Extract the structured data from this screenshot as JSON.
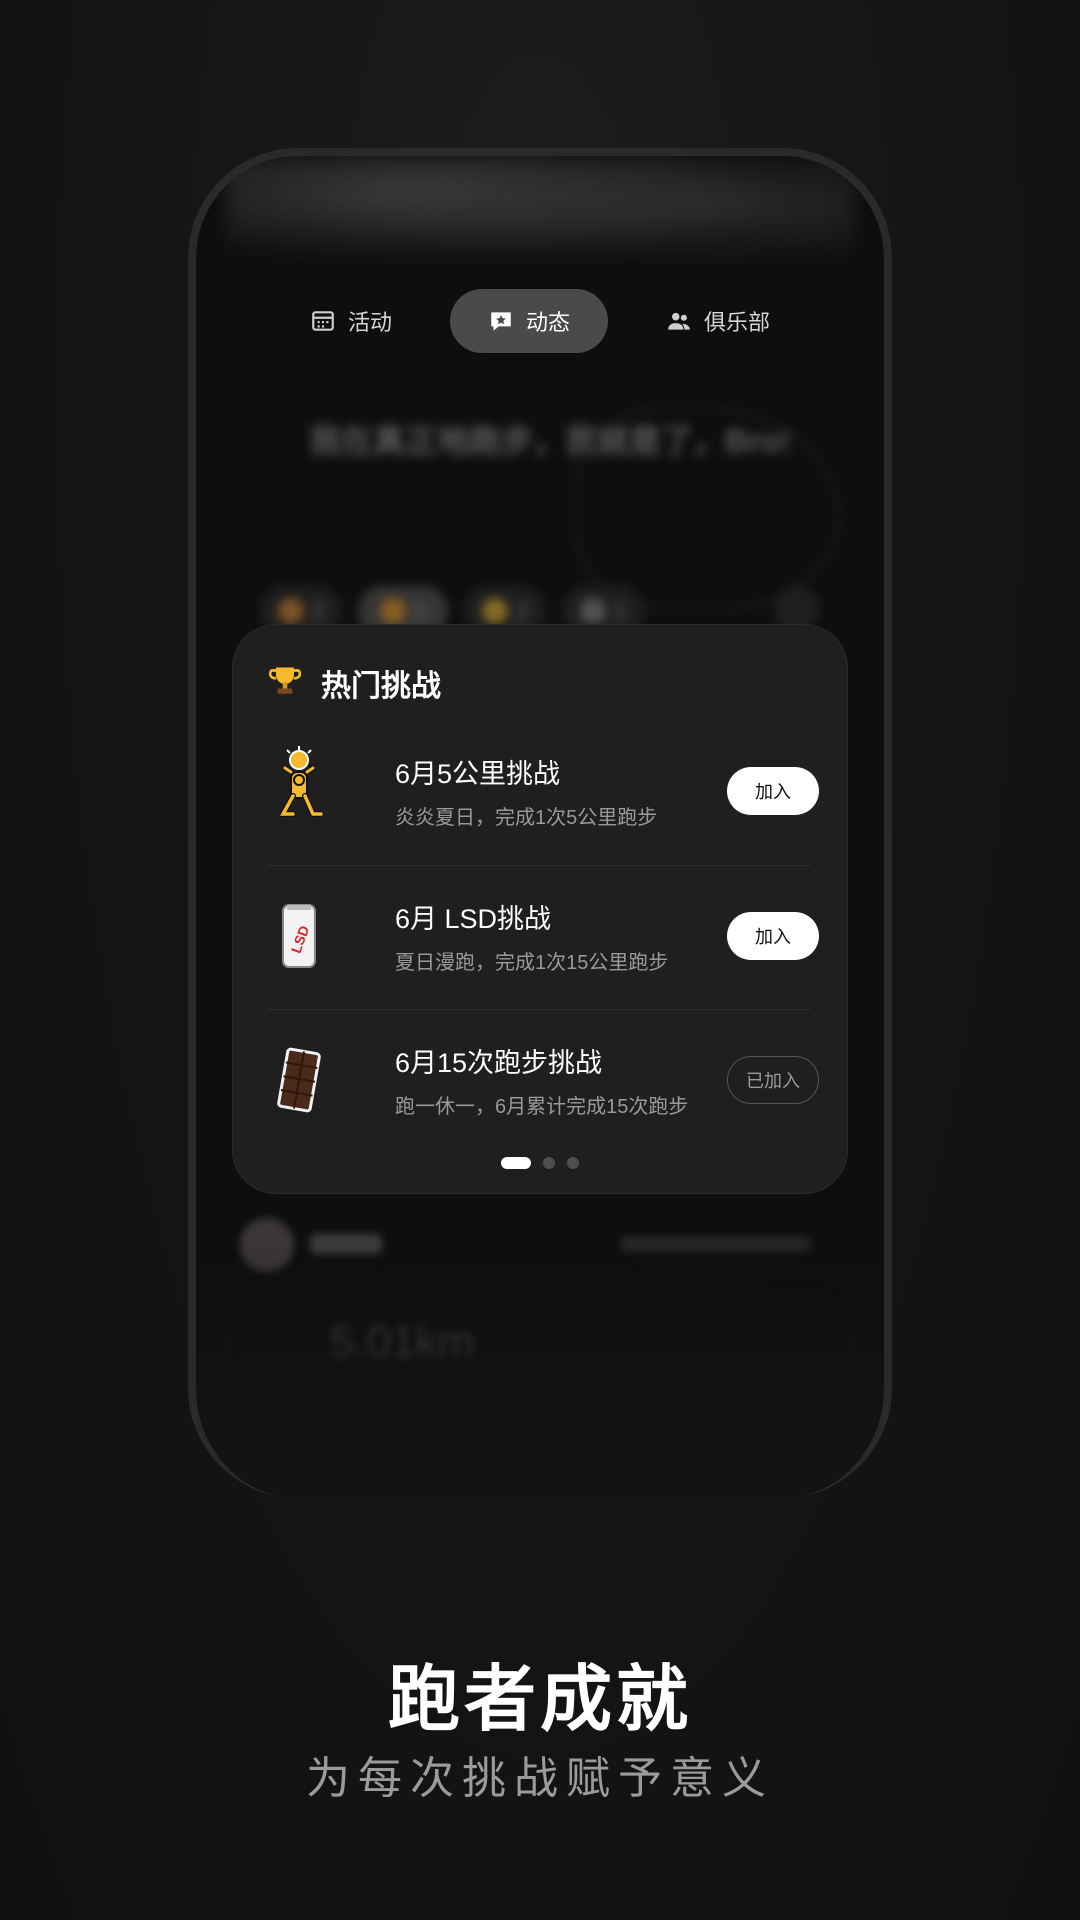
{
  "tabs": [
    {
      "label": "活动",
      "icon": "calendar-icon",
      "active": false
    },
    {
      "label": "动态",
      "icon": "chat-star-icon",
      "active": true
    },
    {
      "label": "俱乐部",
      "icon": "people-icon",
      "active": false
    }
  ],
  "background_post": {
    "title": "我在真正地跑步，我就是了，Bro!",
    "reactions": [
      {
        "icon": "party-icon",
        "count": "2"
      },
      {
        "icon": "smile-icon",
        "count": "6"
      },
      {
        "icon": "thumbs-up-icon",
        "count": "2"
      },
      {
        "icon": "wrench-icon",
        "count": "1"
      }
    ]
  },
  "challenge_card": {
    "title": "热门挑战",
    "items": [
      {
        "title": "6月5公里挑战",
        "subtitle": "炎炎夏日，完成1次5公里跑步",
        "button": "加入",
        "joined": false,
        "icon": "runner-sun-icon"
      },
      {
        "title": "6月 LSD挑战",
        "subtitle": "夏日漫跑，完成1次15公里跑步",
        "button": "加入",
        "joined": false,
        "icon": "lsd-can-icon"
      },
      {
        "title": "6月15次跑步挑战",
        "subtitle": "跑一休一，6月累计完成15次跑步",
        "button": "已加入",
        "joined": true,
        "icon": "chocolate-icon"
      }
    ],
    "page_count": 3,
    "active_page": 1
  },
  "lower_post": {
    "distance": "5.01km"
  },
  "caption": {
    "headline": "跑者成就",
    "subline": "为每次挑战赋予意义"
  },
  "colors": {
    "background": "#141414",
    "card": "#1f1f1f",
    "active_tab": "#4a4a4a",
    "accent_yellow": "#f5b92e"
  }
}
